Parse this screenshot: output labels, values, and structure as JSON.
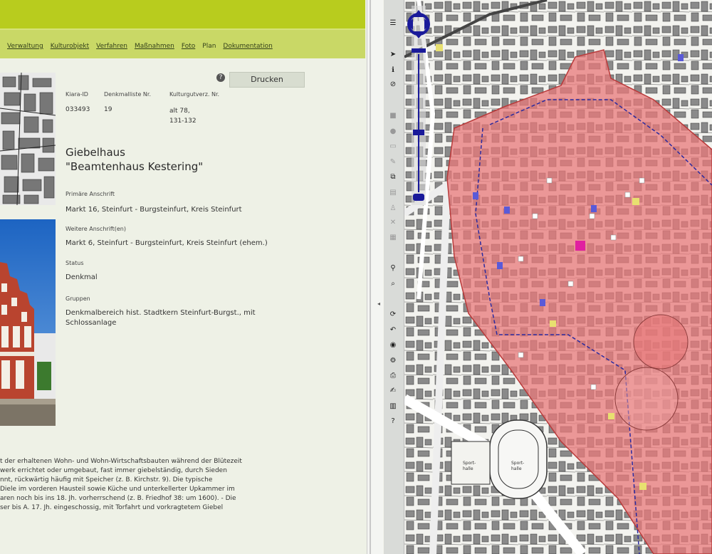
{
  "nav": {
    "links": [
      "Verwaltung",
      "Kulturobjekt",
      "Verfahren",
      "Maßnahmen",
      "Foto",
      "Plan",
      "Dokumentation"
    ]
  },
  "actions": {
    "print_label": "Drucken"
  },
  "record": {
    "headers": [
      "Kiara-ID",
      "Denkmalliste Nr.",
      "Kulturgutverz. Nr."
    ],
    "values": [
      "033493",
      "19",
      "alt 78,\n131-132"
    ],
    "title_line1": "Giebelhaus",
    "title_line2": "\"Beamtenhaus Kestering\"",
    "primary_address_label": "Primäre Anschrift",
    "primary_address": "Markt 16, Steinfurt - Burgsteinfurt, Kreis Steinfurt",
    "other_address_label": "Weitere Anschrift(en)",
    "other_address": "Markt 6, Steinfurt - Burgsteinfurt, Kreis Steinfurt (ehem.)",
    "status_label": "Status",
    "status": "Denkmal",
    "groups_label": "Gruppen",
    "groups": "Denkmalbereich hist. Stadtkern Steinfurt-Burgst., mit Schlossanlage"
  },
  "description": [
    "t der erhaltenen Wohn- und Wohn-Wirtschaftsbauten während der Blütezeit",
    "werk errichtet oder umgebaut, fast immer giebelständig, durch Sieden",
    "nnt, rückwärtig häufig mit Speicher (z. B. Kirchstr. 9). Die typische",
    "Diele im vorderen Hausteil sowie Küche und unterkellerter Upkammer im",
    "aren noch bis ins 18. Jh. vorherrschend (z. B. Friedhof 38: um 1600). - Die",
    "ser bis A. 17. Jh. eingeschossig, mit Torfahrt und vorkragtetem Giebel"
  ],
  "map": {
    "sport_label_1": "Sport-\nhalle",
    "sport_label_2": "Sport-\nhalle"
  },
  "colors": {
    "accent": "#b8cc1e",
    "highlight_area": "#e8787a"
  }
}
